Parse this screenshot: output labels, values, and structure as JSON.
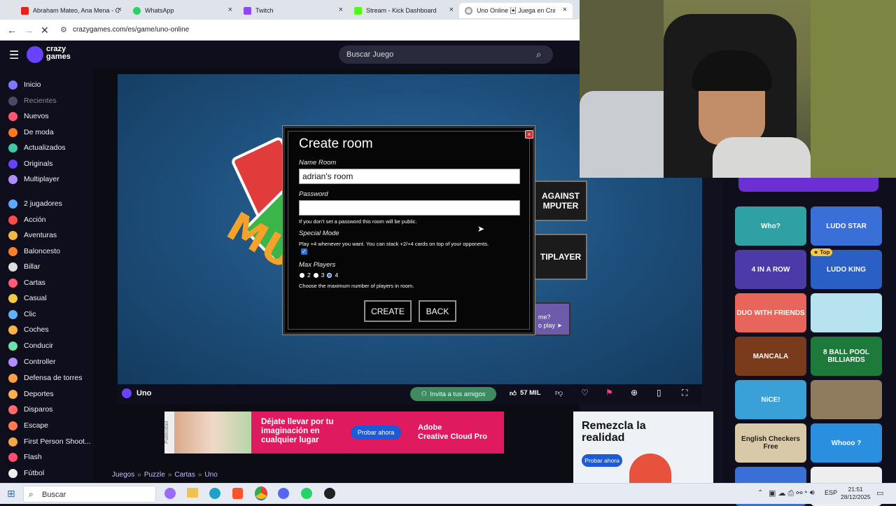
{
  "browser": {
    "tabs": [
      {
        "title": "Abraham Mateo, Ana Mena - C",
        "color": "#e62117"
      },
      {
        "title": "WhatsApp",
        "color": "#25d366"
      },
      {
        "title": "Twitch",
        "color": "#9146ff"
      },
      {
        "title": "Stream - Kick Dashboard",
        "color": "#53fc18"
      },
      {
        "title": "Uno Online 🃏 Juega en CrazyG",
        "color": "#6842ff"
      }
    ],
    "url": "crazygames.com/es/game/uno-online"
  },
  "site": {
    "logo_line1": "crazy",
    "logo_line2": "games",
    "search_placeholder": "Buscar Juego",
    "sidebar": [
      {
        "label": "Inicio",
        "color": "#7d78ff"
      },
      {
        "label": "Recientes",
        "color": "#4a4a66"
      },
      {
        "label": "Nuevos",
        "color": "#ff5577"
      },
      {
        "label": "De moda",
        "color": "#ff7a1a"
      },
      {
        "label": "Actualizados",
        "color": "#41c7a0"
      },
      {
        "label": "Originals",
        "color": "#6842ff"
      },
      {
        "label": "Multiplayer",
        "color": "#b48cff"
      },
      {
        "label": "2 jugadores",
        "color": "#5fa8ff"
      },
      {
        "label": "Acción",
        "color": "#ff4a4a"
      },
      {
        "label": "Aventuras",
        "color": "#f5b642"
      },
      {
        "label": "Baloncesto",
        "color": "#ff7f2a"
      },
      {
        "label": "Billar",
        "color": "#dddddd"
      },
      {
        "label": "Cartas",
        "color": "#ff5a7a"
      },
      {
        "label": "Casual",
        "color": "#f7c843"
      },
      {
        "label": "Clic",
        "color": "#5fb3ff"
      },
      {
        "label": "Coches",
        "color": "#ffb347"
      },
      {
        "label": "Conducir",
        "color": "#6ee0a8"
      },
      {
        "label": "Controller",
        "color": "#b48cff"
      },
      {
        "label": "Defensa de torres",
        "color": "#ff9f43"
      },
      {
        "label": "Deportes",
        "color": "#ffb14e"
      },
      {
        "label": "Disparos",
        "color": "#ff6b6b"
      },
      {
        "label": "Escape",
        "color": "#ff7b54"
      },
      {
        "label": "First Person Shoot...",
        "color": "#f4a742"
      },
      {
        "label": "Flash",
        "color": "#ff4d6d"
      },
      {
        "label": "Fútbol",
        "color": "#eeeeee"
      }
    ],
    "game_title": "Uno",
    "invite_label": "Invita a tus amigos",
    "likes": "57 MIL",
    "breadcrumb": [
      "Juegos",
      "Puzzle",
      "Cartas",
      "Uno"
    ]
  },
  "game": {
    "side_buttons": [
      "AGAINST\nMPUTER",
      "TIPLAYER"
    ],
    "promo_text": "me?",
    "promo_play": "o play ➤",
    "dialog": {
      "title": "Create room",
      "name_label": "Name Room",
      "name_value": "adrian's room",
      "password_label": "Password",
      "password_value": "",
      "password_hint": "If you don't set a password this room will be public.",
      "special_label": "Special Mode",
      "special_desc": "Play +4 whenever you want. You can stack +2/+4 cards on top of your opponents.",
      "special_checked": true,
      "max_label": "Max Players",
      "max_options": [
        "2",
        "3",
        "4"
      ],
      "max_selected": "4",
      "max_hint": "Choose the maximum number of players in room.",
      "create_label": "CREATE",
      "back_label": "BACK"
    }
  },
  "right_games": [
    {
      "label": "Who?",
      "bg": "#2fa1a5"
    },
    {
      "label": "LUDO STAR",
      "bg": "#3a6fd8"
    },
    {
      "label": "4 IN A ROW",
      "bg": "#4c3aa8"
    },
    {
      "label": "LUDO KING",
      "bg": "#2a5fc4"
    },
    {
      "label": "DUO WITH FRIENDS",
      "bg": "#e7655a"
    },
    {
      "label": "",
      "bg": "#b7e2f0"
    },
    {
      "label": "MANCALA",
      "bg": "#7a3b1d"
    },
    {
      "label": "8 BALL POOL BILLIARDS",
      "bg": "#1d7a3a"
    },
    {
      "label": "NiCE!",
      "bg": "#3aa0d8"
    },
    {
      "label": "",
      "bg": "#8f7b5e"
    },
    {
      "label": "English Checkers Free",
      "bg": "#d8c9a8"
    },
    {
      "label": "Whooo ?",
      "bg": "#2b8fe0"
    },
    {
      "label": "",
      "bg": "#3a6fd8"
    },
    {
      "label": "",
      "bg": "#eeeeee"
    }
  ],
  "right_badge": "Top",
  "ads": {
    "ad1_headline": "Déjate llevar por tu imaginación en cualquier lugar",
    "ad1_button": "Probar ahora",
    "ad1_brand": "Adobe",
    "ad1_product": "Creative Cloud Pro",
    "ad1_side": "Publicidad",
    "ad2_headline": "Remezcla la realidad",
    "ad2_button": "Probar ahora"
  },
  "taskbar": {
    "search": "Buscar",
    "lang": "ESP",
    "time": "21:51",
    "date": "28/12/2025"
  }
}
